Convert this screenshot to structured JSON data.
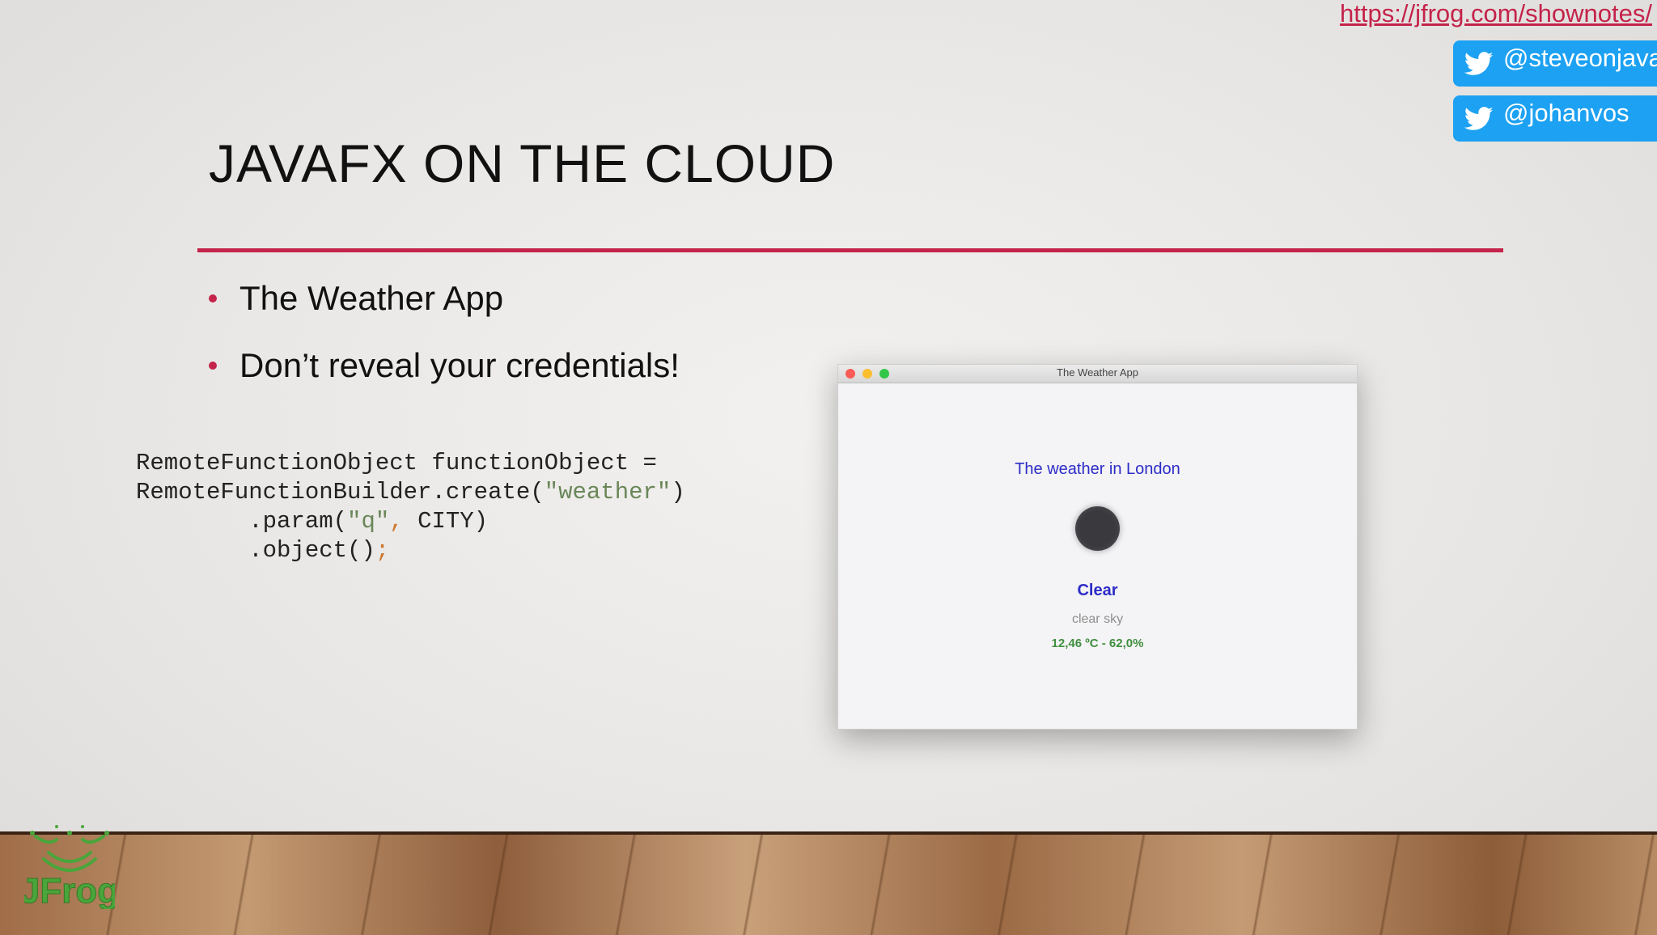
{
  "links": {
    "shownotes": "https://jfrog.com/shownotes/"
  },
  "social": {
    "handles": [
      "@steveonjava",
      "@johanvos"
    ],
    "badge_color": "#1da1f2",
    "icon": "twitter-bird-icon"
  },
  "slide": {
    "title": "JAVAFX ON THE CLOUD",
    "accent_color": "#c4234a",
    "bullets": [
      "The Weather App",
      "Don’t reveal your credentials!"
    ],
    "code": {
      "line1": "RemoteFunctionObject functionObject =",
      "line2_pre": "RemoteFunctionBuilder.create(",
      "line2_str": "\"weather\"",
      "line2_post": ")",
      "line3_pre": "        .param(",
      "line3_str": "\"q\"",
      "line3_sep": ",",
      "line3_post": " CITY)",
      "line4_pre": "        .object()",
      "line4_semi": ";"
    }
  },
  "app_window": {
    "title": "The Weather App",
    "heading": "The weather in London",
    "condition": "Clear",
    "description": "clear sky",
    "temperature": "12,46 ºC - 62,0%",
    "weather_icon": "clear-weather-icon"
  },
  "branding": {
    "logo_text": "JFrog",
    "logo_color": "#4aa53a"
  }
}
